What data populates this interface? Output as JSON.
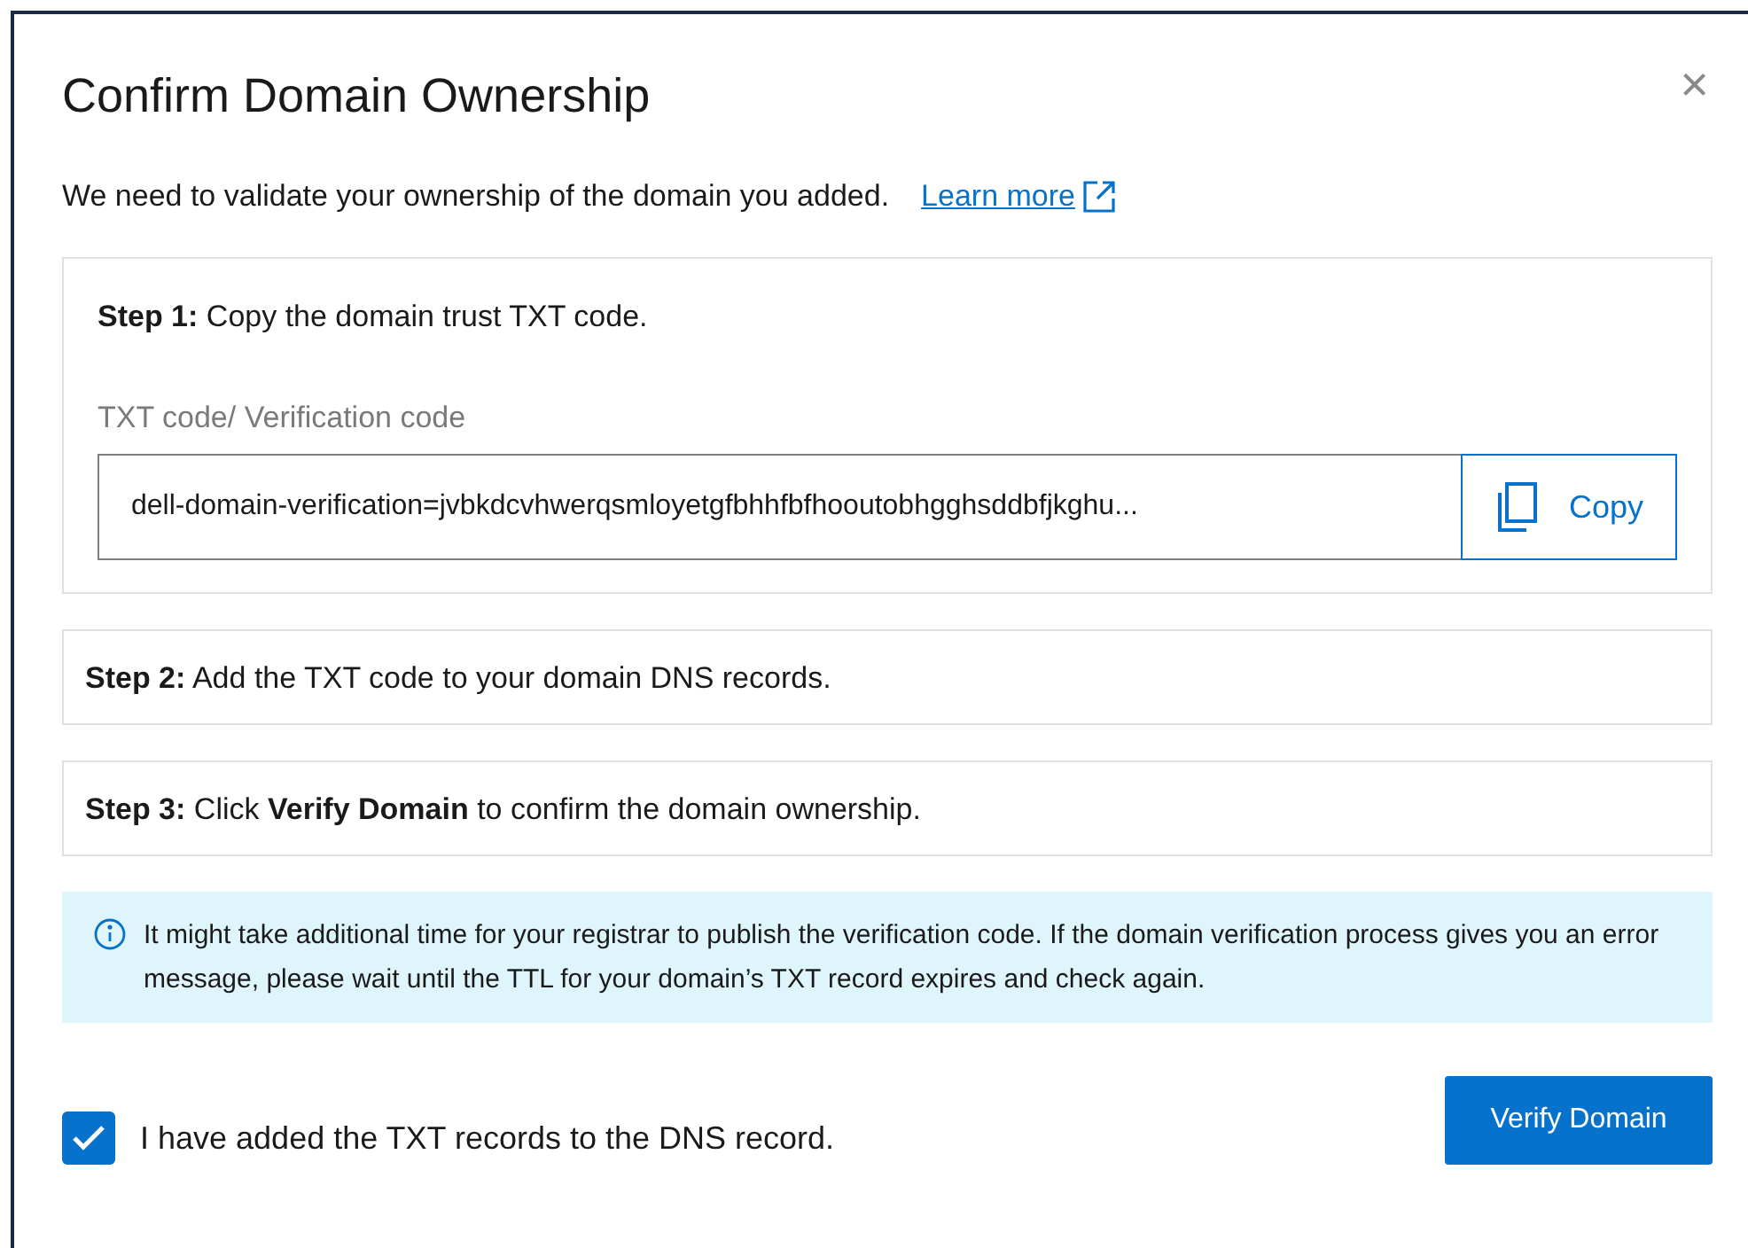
{
  "dialog": {
    "title": "Confirm Domain Ownership",
    "close": "×"
  },
  "intro": {
    "text": "We need to validate your ownership of the domain you added.",
    "link": "Learn more"
  },
  "steps": [
    {
      "kind": "copy",
      "text": "**Step 1:** Copy the domain trust TXT code.",
      "field_label": "TXT code/ Verification code",
      "value": "dell-domain-verification=jvbkdcvhwerqsmloyetgfbhhfbfhooutobhgghsddbfjkghu...",
      "button": "Copy"
    },
    {
      "kind": "plain",
      "text": "**Step 2:** Add the TXT code to your domain DNS records."
    },
    {
      "kind": "plain",
      "text": "**Step 3:** Click **Verify Domain** to confirm the domain ownership."
    }
  ],
  "info": {
    "text": "It might take additional time for your registrar to publish the verification code. If the domain verification process gives you an error message, please wait until the TTL for your domain’s TXT record expires and check again."
  },
  "confirm": {
    "label": "I have added the TXT records to the DNS record.",
    "checked": true
  },
  "buttons": [
    "Verify Domain"
  ]
}
